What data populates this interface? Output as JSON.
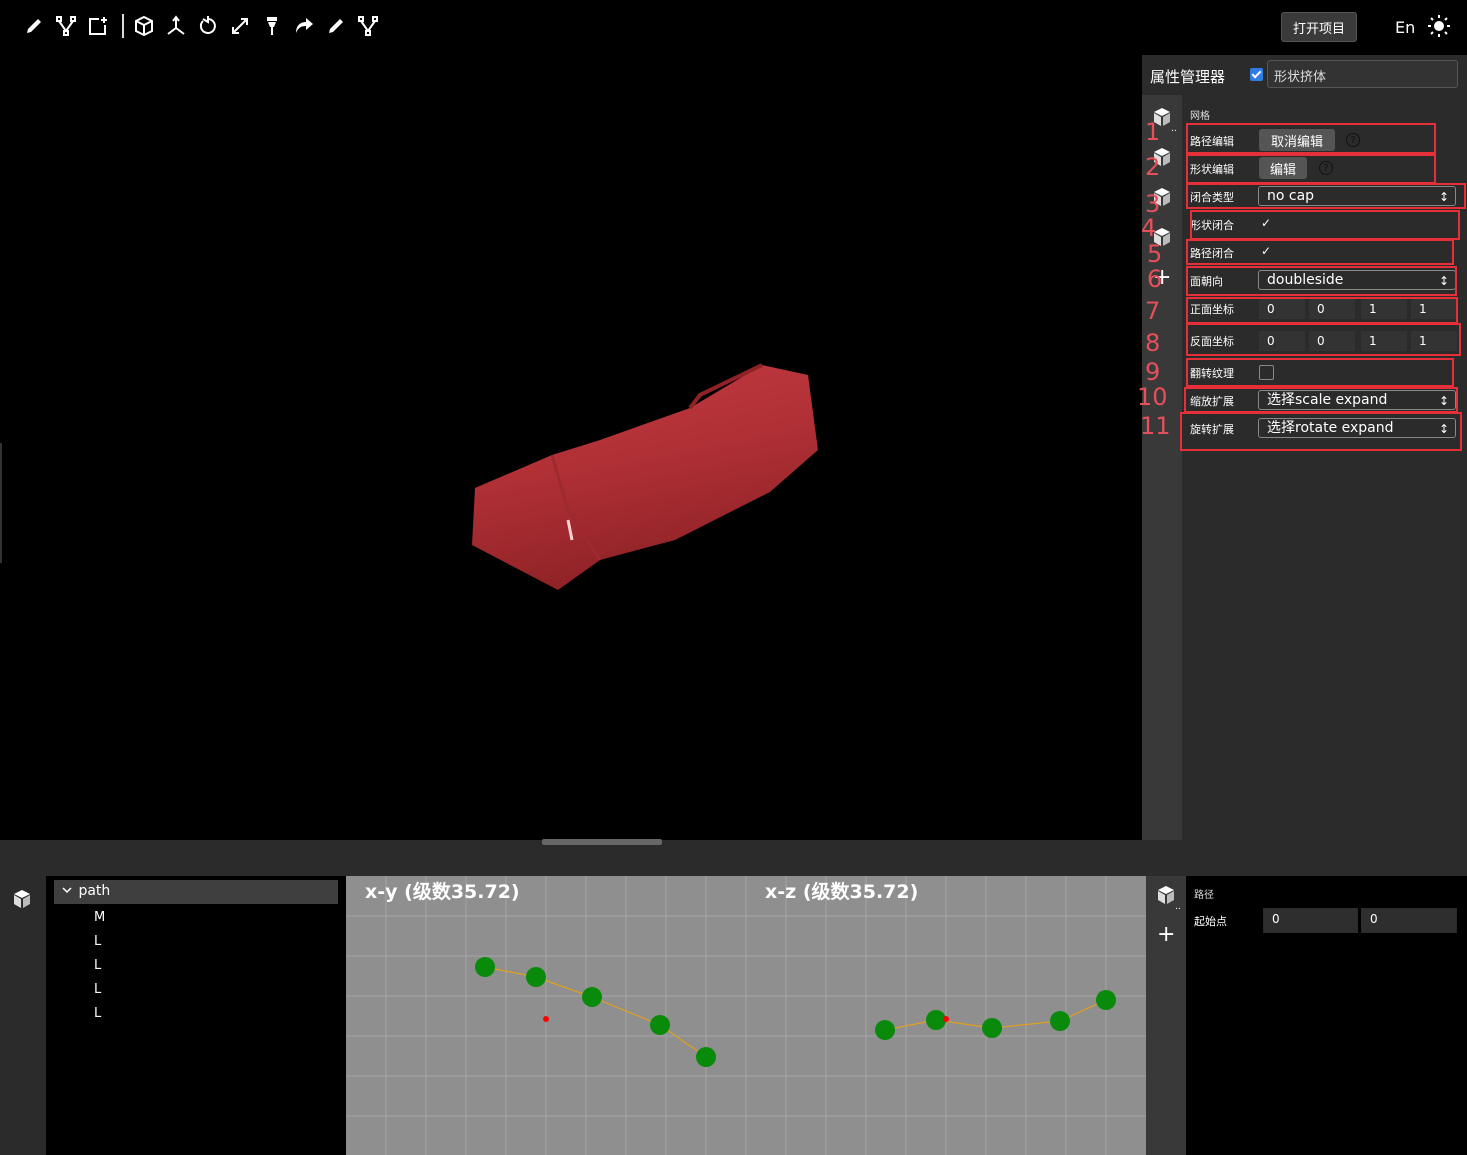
{
  "toolbar": {
    "icons": [
      "pencil-icon",
      "bezier-icon",
      "add-shape-icon",
      "cube-icon",
      "axes-icon",
      "rotate-icon",
      "scale-icon",
      "lamp-icon",
      "redo-icon",
      "pen-icon",
      "nodes-icon"
    ],
    "open_project": "打开项目",
    "language": "En",
    "theme_icon": "sun-icon"
  },
  "property_panel": {
    "title": "属性管理器",
    "object_name": "形状挤体",
    "section": "网格",
    "rows": {
      "path_edit": {
        "label": "路径编辑",
        "button": "取消编辑"
      },
      "shape_edit": {
        "label": "形状编辑",
        "button": "编辑"
      },
      "cap_type": {
        "label": "闭合类型",
        "value": "no cap"
      },
      "shape_closed": {
        "label": "形状闭合",
        "value": "✓"
      },
      "path_closed": {
        "label": "路径闭合",
        "value": "✓"
      },
      "side_orientation": {
        "label": "面朝向",
        "value": "doubleside"
      },
      "front_uvs": {
        "label": "正面坐标",
        "values": [
          "0",
          "0",
          "1",
          "1"
        ]
      },
      "back_uvs": {
        "label": "反面坐标",
        "values": [
          "0",
          "0",
          "1",
          "1"
        ]
      },
      "invert_uv": {
        "label": "翻转纹理"
      },
      "scale_expand": {
        "label": "缩放扩展",
        "value": "选择scale expand"
      },
      "rotate_expand": {
        "label": "旋转扩展",
        "value": "选择rotate expand"
      }
    },
    "annotations": [
      "1",
      "2",
      "3",
      "4",
      "5",
      "6",
      "7",
      "8",
      "9",
      "10",
      "11"
    ],
    "help_mark": "?",
    "select_arrow": "↕",
    "plus": "+"
  },
  "tree": {
    "root": "path",
    "items": [
      "M",
      "L",
      "L",
      "L",
      "L"
    ]
  },
  "plots": {
    "xy_title": "x-y (级数35.72)",
    "xz_title": "x-z (级数35.72)"
  },
  "path_panel": {
    "section": "路径",
    "start_label": "起始点",
    "start_values": [
      "0",
      "0"
    ],
    "plus": "+"
  },
  "colors": {
    "accent": "#2f7de1",
    "annotation": "#e5303a",
    "mesh": "#b03036",
    "point": "#0a8a0a",
    "line": "#e0a020"
  }
}
